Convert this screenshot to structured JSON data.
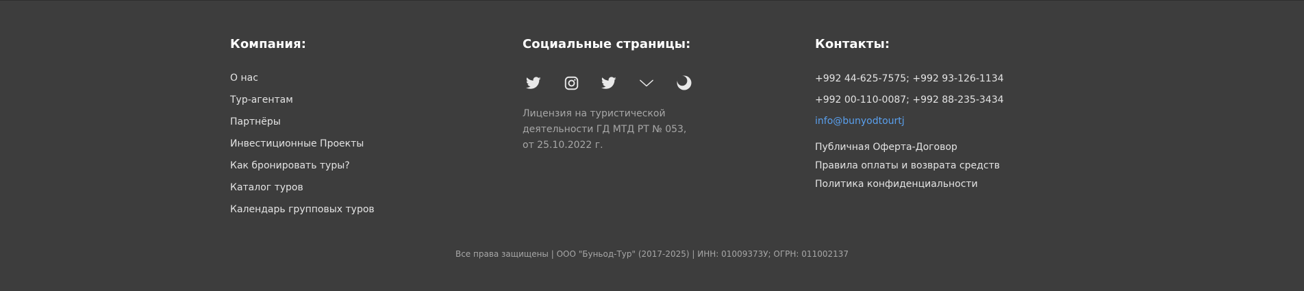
{
  "company": {
    "title": "Компания:",
    "links": [
      "О нас",
      "Тур-агентам",
      "Партнёры",
      "Инвестиционные Проекты",
      "Как бронировать туры?",
      "Каталог туров",
      "Календарь групповых туров"
    ]
  },
  "social": {
    "title": "Социальные страницы:",
    "icons": [
      "twitter-icon",
      "instagram-icon",
      "twitter-icon",
      "vk-icon",
      "odnoklassniki-icon"
    ],
    "license": "Лицензия на туристической деятельности ГД МТД РТ № 053, от 25.10.2022 г."
  },
  "contacts": {
    "title": "Контакты:",
    "phones": [
      "+992 44-625-7575; +992 93-126-1134",
      "+992 00-110-0087; +992 88-235-3434"
    ],
    "email": "info@bunyodtourtj",
    "docs": [
      "Публичная Оферта-Договор",
      "Правила оплаты и возврата средств",
      "Политика конфиденциальности"
    ]
  },
  "copyright": "Все права защищены | ООО \"Буньод-Тур\" (2017-2025) | ИНН: 01009373У; ОГРН: 011002137",
  "colors": {
    "background": "#3d3d3d",
    "title": "#ffffff",
    "link": "#e4e4e4",
    "muted": "#a7a7a7",
    "email": "#5aa0ee"
  }
}
